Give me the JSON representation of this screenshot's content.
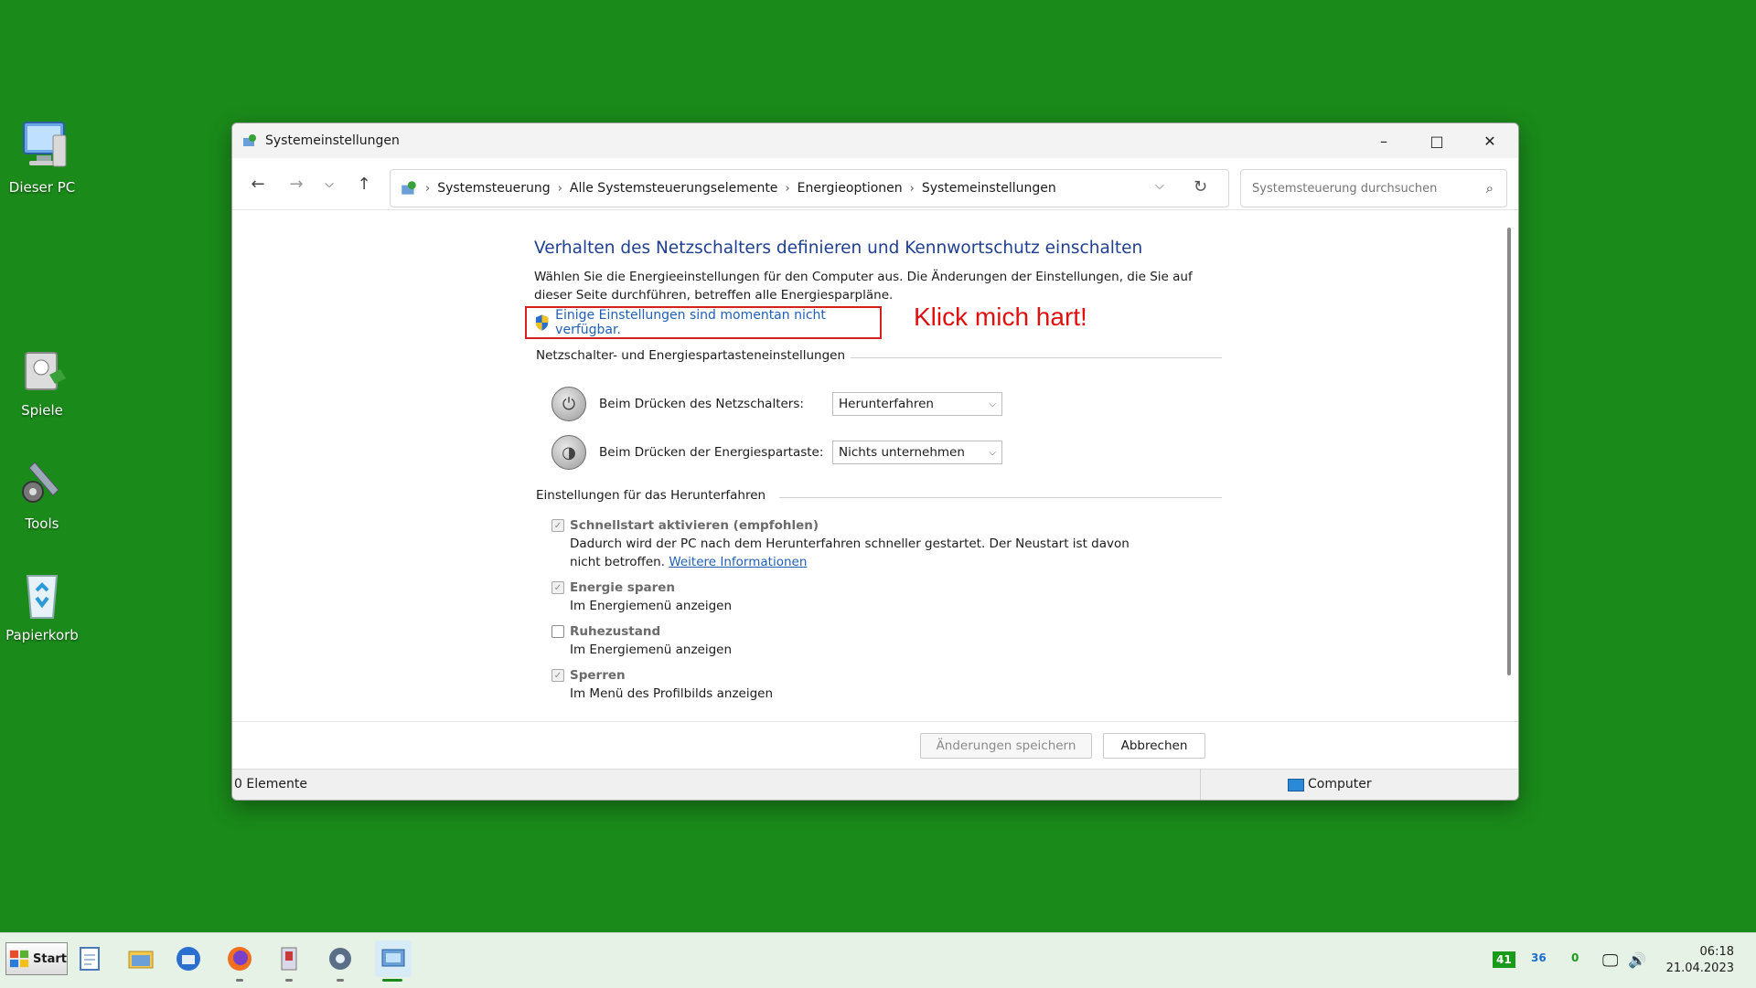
{
  "desktop": {
    "icons": [
      {
        "label": "Dieser PC"
      },
      {
        "label": "Spiele"
      },
      {
        "label": "Tools"
      },
      {
        "label": "Papierkorb"
      }
    ]
  },
  "window": {
    "title": "Systemeinstellungen",
    "breadcrumb": [
      "Systemsteuerung",
      "Alle Systemsteuerungselemente",
      "Energieoptionen",
      "Systemeinstellungen"
    ],
    "search_placeholder": "Systemsteuerung durchsuchen",
    "heading": "Verhalten des Netzschalters definieren und Kennwortschutz einschalten",
    "description": "Wählen Sie die Energieeinstellungen für den Computer aus. Die Änderungen der Einstellungen, die Sie auf dieser Seite durchführen, betreffen alle Energiesparpläne.",
    "uac_link": "Einige Einstellungen sind momentan nicht verfügbar.",
    "annotation": "Klick mich hart!",
    "power_group": {
      "title": "Netzschalter- und Energiespartasteneinstellungen",
      "rows": [
        {
          "label": "Beim Drücken des Netzschalters:",
          "value": "Herunterfahren"
        },
        {
          "label": "Beim Drücken der Energiespartaste:",
          "value": "Nichts unternehmen"
        }
      ]
    },
    "shutdown_group": {
      "title": "Einstellungen für das Herunterfahren",
      "options": [
        {
          "name": "Schnellstart aktivieren (empfohlen)",
          "checked": true,
          "desc": "Dadurch wird der PC nach dem Herunterfahren schneller gestartet. Der Neustart ist davon nicht betroffen.",
          "link": "Weitere Informationen"
        },
        {
          "name": "Energie sparen",
          "checked": true,
          "desc": "Im Energiemenü anzeigen"
        },
        {
          "name": "Ruhezustand",
          "checked": false,
          "desc": "Im Energiemenü anzeigen"
        },
        {
          "name": "Sperren",
          "checked": true,
          "desc": "Im Menü des Profilbilds anzeigen"
        }
      ]
    },
    "buttons": {
      "save": "Änderungen speichern",
      "cancel": "Abbrechen"
    },
    "status": {
      "items": "0 Elemente",
      "location": "Computer"
    }
  },
  "taskbar": {
    "start_label": "Start",
    "tray": [
      "41",
      "36",
      "0"
    ],
    "time": "06:18",
    "date": "21.04.2023"
  }
}
